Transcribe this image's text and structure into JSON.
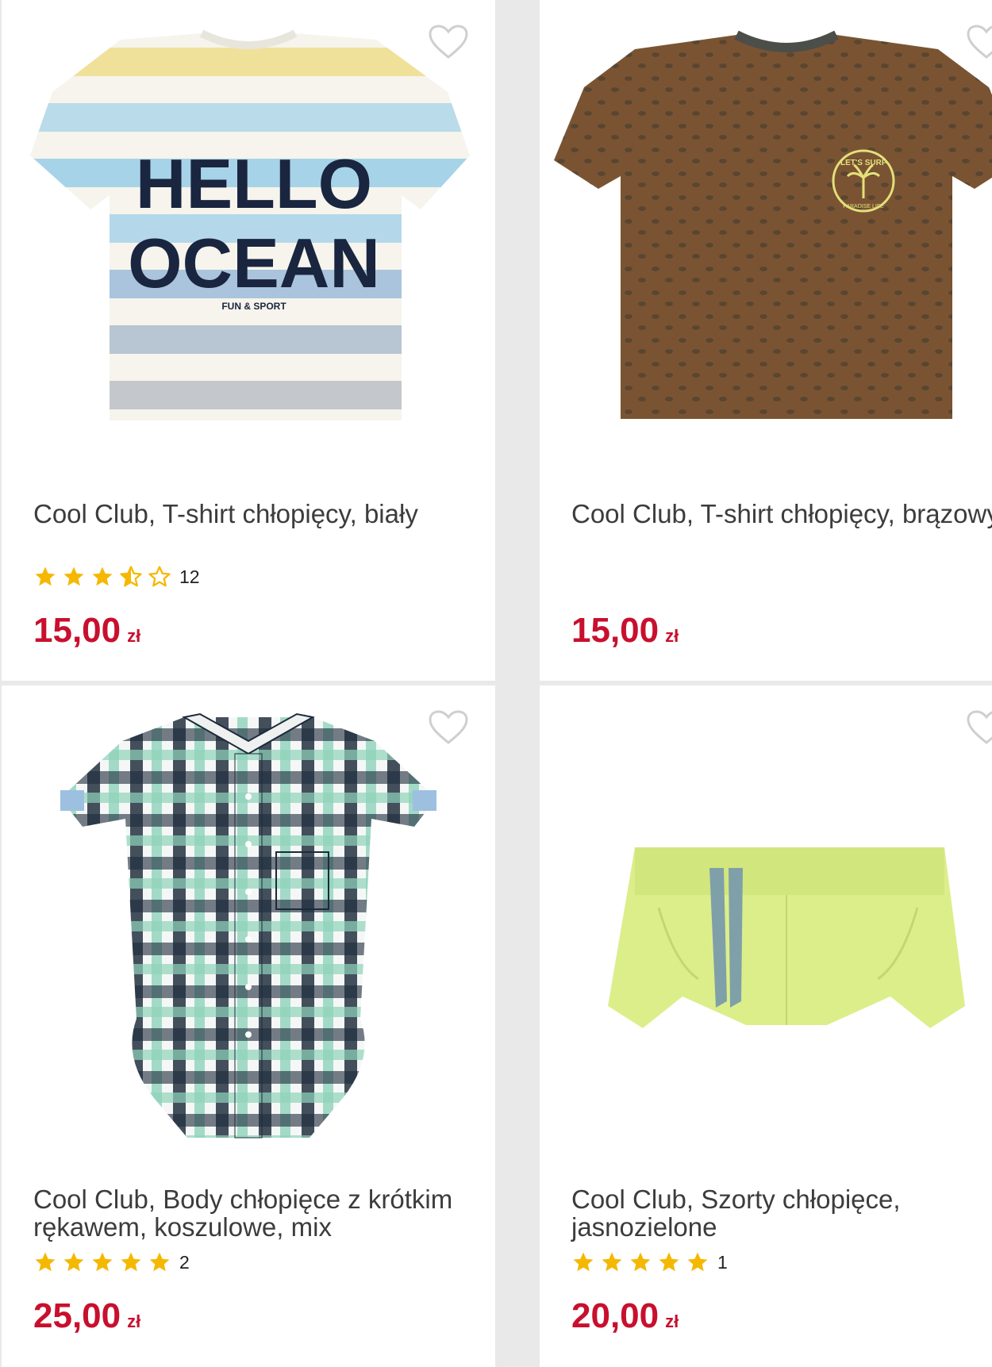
{
  "products": [
    {
      "title": "Cool Club, T-shirt chłopięcy, biały",
      "image": "striped-tshirt-hello-ocean",
      "rating": 3.5,
      "rating_count": "12",
      "price": "15,00",
      "currency": "zł",
      "print_text": [
        "HELLO",
        "OCEAN",
        "FUN & SPORT"
      ]
    },
    {
      "title": "Cool Club, T-shirt chłopięcy, brązowy",
      "image": "brown-tshirt-lets-surf",
      "price": "15,00",
      "currency": "zł",
      "print_text": [
        "LET'S SURF",
        "PARADISE LIFE"
      ]
    },
    {
      "title": "Cool Club, Body chłopięce z krótkim rękawem, koszulowe, mix",
      "image": "plaid-shirt-bodysuit",
      "rating": 5,
      "rating_count": "2",
      "price": "25,00",
      "currency": "zł"
    },
    {
      "title": "Cool Club, Szorty chłopięce, jasnozielone",
      "image": "light-green-shorts",
      "rating": 5,
      "rating_count": "1",
      "price": "20,00",
      "currency": "zł"
    }
  ],
  "icons": {
    "favorite": "heart-outline-icon",
    "star": "star-icon"
  },
  "colors": {
    "price": "#c8102e",
    "star": "#f5b800",
    "heart": "#cfcfcf",
    "background": "#e9e9e9"
  }
}
